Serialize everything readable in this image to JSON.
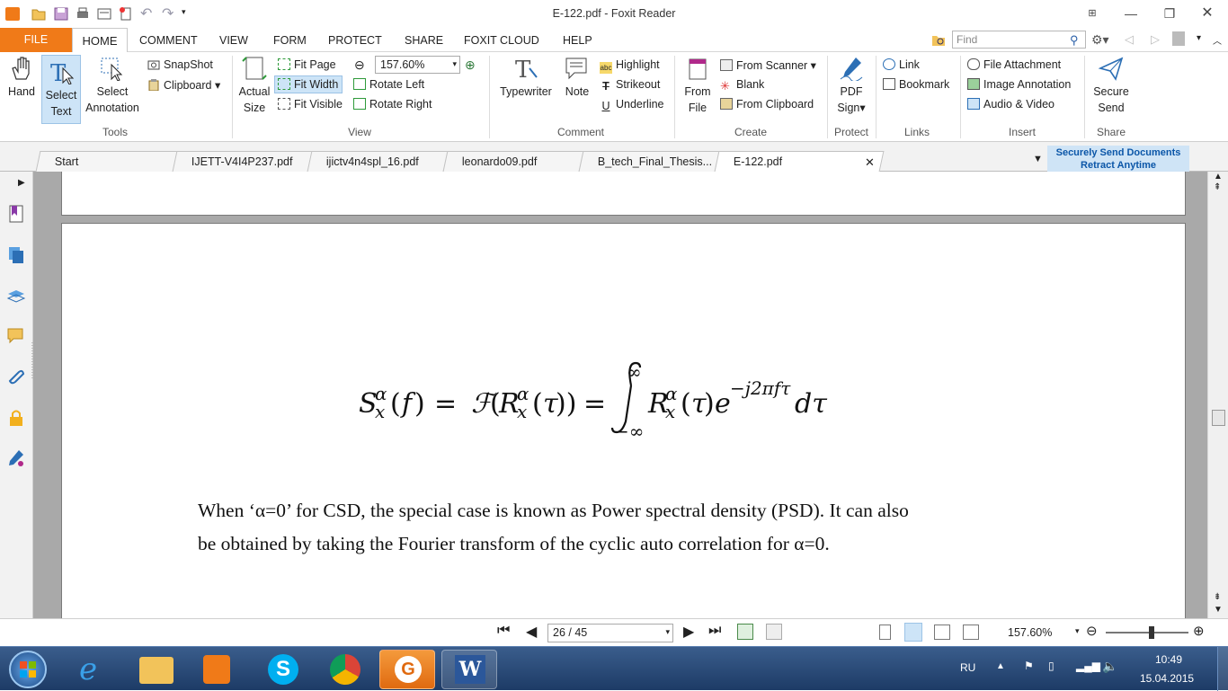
{
  "window": {
    "title": "E-122.pdf - Foxit Reader"
  },
  "menu": {
    "file": "FILE",
    "home": "HOME",
    "comment": "COMMENT",
    "view": "VIEW",
    "form": "FORM",
    "protect": "PROTECT",
    "share": "SHARE",
    "foxit_cloud": "FOXIT CLOUD",
    "help": "HELP",
    "find_placeholder": "Find"
  },
  "ribbon": {
    "tools": {
      "label": "Tools",
      "hand": "Hand",
      "select_text_1": "Select",
      "select_text_2": "Text",
      "select_annot_1": "Select",
      "select_annot_2": "Annotation",
      "snapshot": "SnapShot",
      "clipboard": "Clipboard"
    },
    "view": {
      "label": "View",
      "actual_1": "Actual",
      "actual_2": "Size",
      "fit_page": "Fit Page",
      "fit_width": "Fit Width",
      "fit_visible": "Fit Visible",
      "zoom": "157.60%",
      "rotate_left": "Rotate Left",
      "rotate_right": "Rotate Right"
    },
    "comment": {
      "label": "Comment",
      "typewriter": "Typewriter",
      "note": "Note",
      "highlight": "Highlight",
      "strikeout": "Strikeout",
      "underline": "Underline"
    },
    "create": {
      "label": "Create",
      "from_file_1": "From",
      "from_file_2": "File",
      "from_scanner": "From Scanner",
      "blank": "Blank",
      "from_clipboard": "From Clipboard"
    },
    "protect": {
      "label": "Protect",
      "pdf_sign_1": "PDF",
      "pdf_sign_2": "Sign"
    },
    "links": {
      "label": "Links",
      "link": "Link",
      "bookmark": "Bookmark"
    },
    "insert": {
      "label": "Insert",
      "file_attachment": "File Attachment",
      "image_annotation": "Image Annotation",
      "audio_video": "Audio & Video"
    },
    "share": {
      "label": "Share",
      "secure_send_1": "Secure",
      "secure_send_2": "Send"
    }
  },
  "tabs": [
    "Start",
    "IJETT-V4I4P237.pdf",
    "ijictv4n4spl_16.pdf",
    "leonardo09.pdf",
    "B_tech_Final_Thesis...",
    "E-122.pdf"
  ],
  "promo": {
    "line1": "Securely Send Documents",
    "line2": "Retract Anytime"
  },
  "document": {
    "paragraph_line1": "When ‘α=0’ for CSD, the special case is known as Power spectral density (PSD). It can also",
    "paragraph_line2": "be obtained by taking the Fourier transform of the cyclic auto correlation for α=0."
  },
  "status": {
    "page": "26 / 45",
    "zoom": "157.60%"
  },
  "taskbar": {
    "lang": "RU",
    "time": "10:49",
    "date": "15.04.2015"
  }
}
